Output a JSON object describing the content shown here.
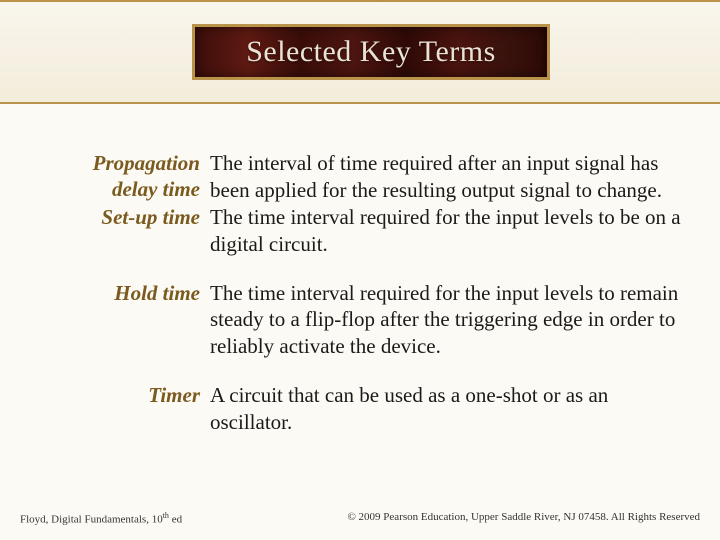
{
  "title": "Selected Key Terms",
  "terms": [
    {
      "label": "Propagation delay time",
      "definition": "The interval of time required after an input signal has been applied for the resulting output signal to change."
    },
    {
      "label": "Set-up time",
      "definition": "The time interval required for the input levels to be on a digital circuit."
    },
    {
      "label": "Hold time",
      "definition": "The time interval required for the input levels to remain steady to a flip-flop after the triggering edge in order to reliably activate the device."
    },
    {
      "label": "Timer",
      "definition": "A circuit that can be used as a one-shot or as an oscillator."
    }
  ],
  "footer": {
    "left_prefix": "Floyd, Digital Fundamentals, 10",
    "left_sup": "th",
    "left_suffix": " ed",
    "right": "© 2009 Pearson Education, Upper Saddle River, NJ 07458. All Rights Reserved"
  }
}
